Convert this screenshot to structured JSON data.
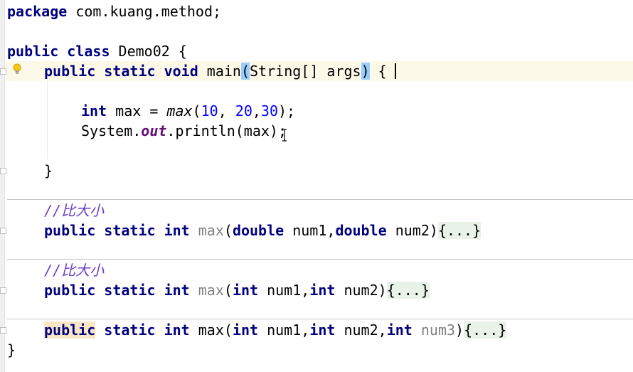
{
  "editor": {
    "language": "java",
    "lines": {
      "package": {
        "kw": "package",
        "rest": " com.kuang.method;"
      },
      "class_decl": {
        "kw1": "public",
        "kw2": "class",
        "rest": " Demo02 {"
      },
      "main_decl": {
        "kw1": "public",
        "kw2": "static",
        "kw3": "void",
        "name": " main",
        "lparen": "(",
        "params": "String[] args",
        "rparen": ")",
        "tail": " {"
      },
      "max_call": {
        "type": "int",
        "pre": " max = ",
        "fn": "max",
        "open": "(",
        "a": "10",
        "c1": ", ",
        "b": "20",
        "c2": ",",
        "c": "30",
        "close": ");"
      },
      "println": {
        "pre": "System.",
        "field": "out",
        "post": ".println(max);"
      },
      "main_close": "}",
      "comment1": "//比大小",
      "max_double": {
        "kw1": "public",
        "kw2": "static",
        "kw3": "int",
        "name": "max",
        "open": "(",
        "t1": "double",
        "p1": " num1,",
        "t2": "double",
        "p2": " num2)",
        "fold": "{...}"
      },
      "comment2": "//比大小",
      "max_int2": {
        "kw1": "public",
        "kw2": "static",
        "kw3": "int",
        "name": "max",
        "open": "(",
        "t1": "int",
        "p1": " num1,",
        "t2": "int",
        "p2": " num2)",
        "fold": "{...}"
      },
      "max_int3": {
        "kw1": "public",
        "kw2": "static",
        "kw3": "int",
        "name": " max",
        "open": "(",
        "t1": "int",
        "p1": " num1,",
        "t2": "int",
        "p2": " num2,",
        "t3": "int",
        "p3": "num3",
        "close": ")",
        "fold": "{...}"
      },
      "class_close": "}"
    }
  },
  "icons": {
    "intention": "lightbulb-icon",
    "fold": "fold-marker-icon",
    "cursor": "text-cursor-icon"
  },
  "colors": {
    "keyword": "#000080",
    "number": "#0000ff",
    "comment": "#6a3fc8",
    "field": "#660e7a",
    "unused": "#808080",
    "current_line": "#fdf9e8",
    "brace_match": "#99ccff",
    "folded_block": "#e8f2e8"
  }
}
